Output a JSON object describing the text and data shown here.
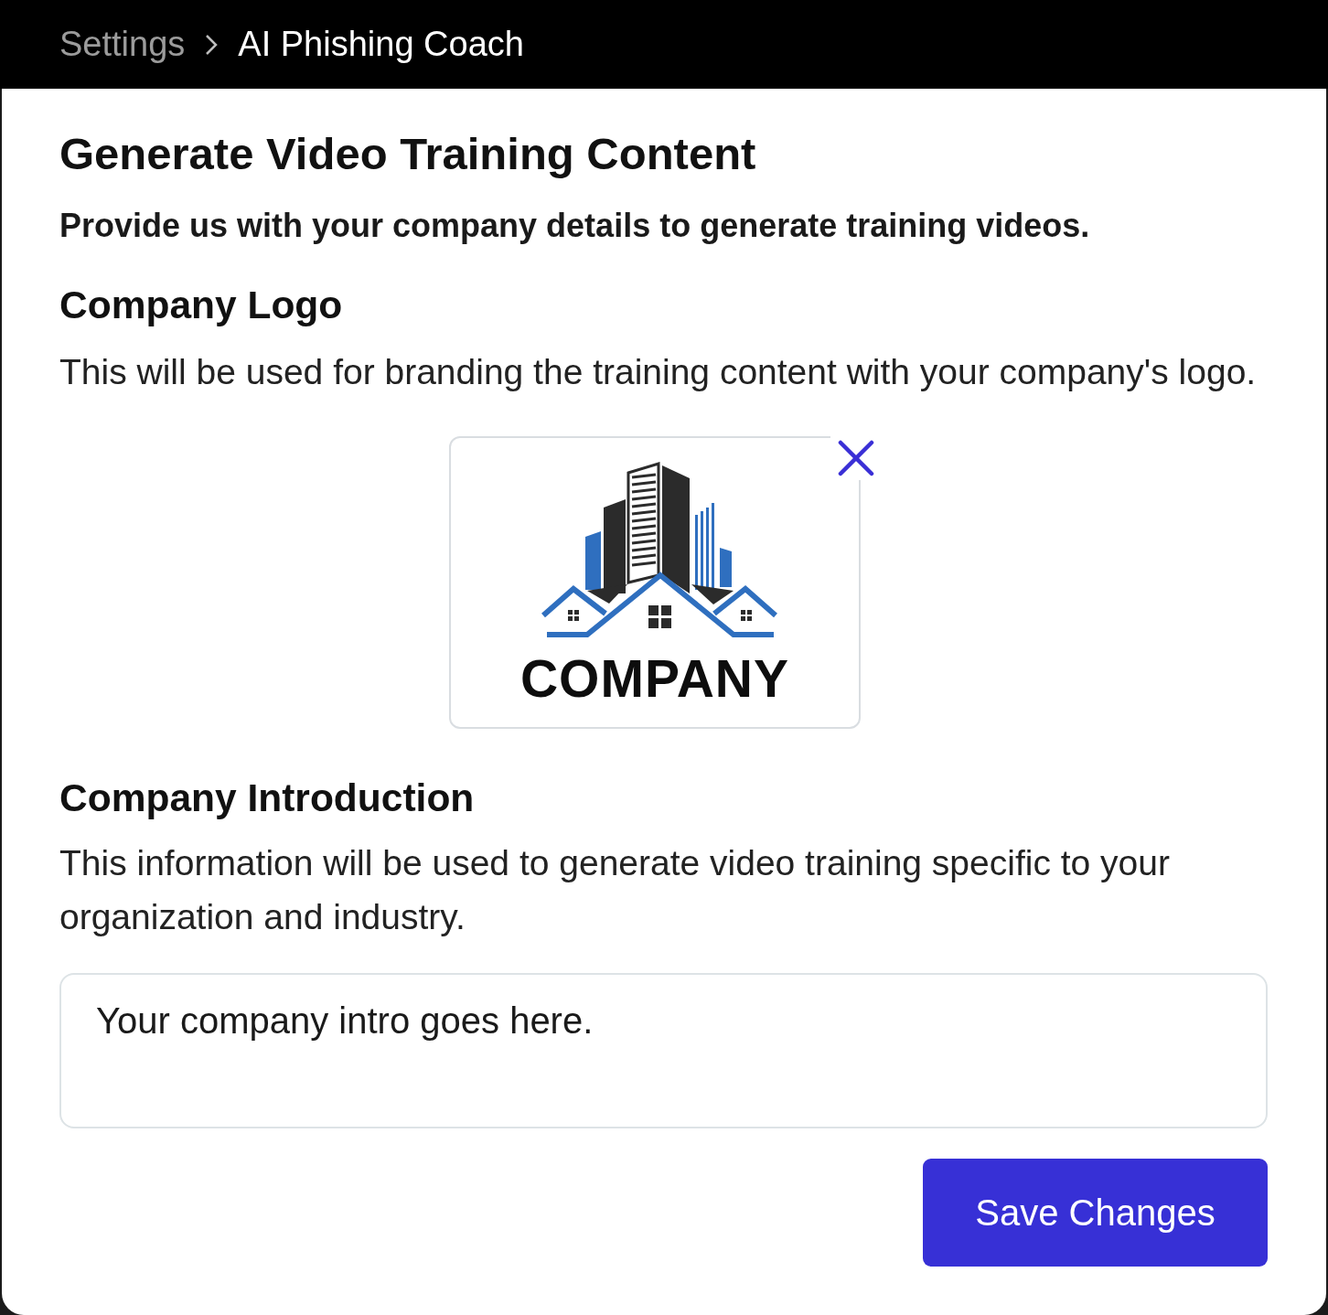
{
  "breadcrumb": [
    {
      "label": "Settings",
      "current": false
    },
    {
      "label": "AI Phishing Coach",
      "current": true
    }
  ],
  "page": {
    "title": "Generate Video Training Content",
    "subtitle": "Provide us with your company details to generate training videos."
  },
  "logo_section": {
    "heading": "Company Logo",
    "description": "This will be used for branding the training content with your company's logo.",
    "logo": {
      "wordmark": "COMPANY"
    }
  },
  "intro_section": {
    "heading": "Company Introduction",
    "description": "This information will be used to generate video training specific to your organization and industry.",
    "intro_field": {
      "value": "Your company intro goes here."
    }
  },
  "save_button": {
    "label": "Save Changes"
  }
}
